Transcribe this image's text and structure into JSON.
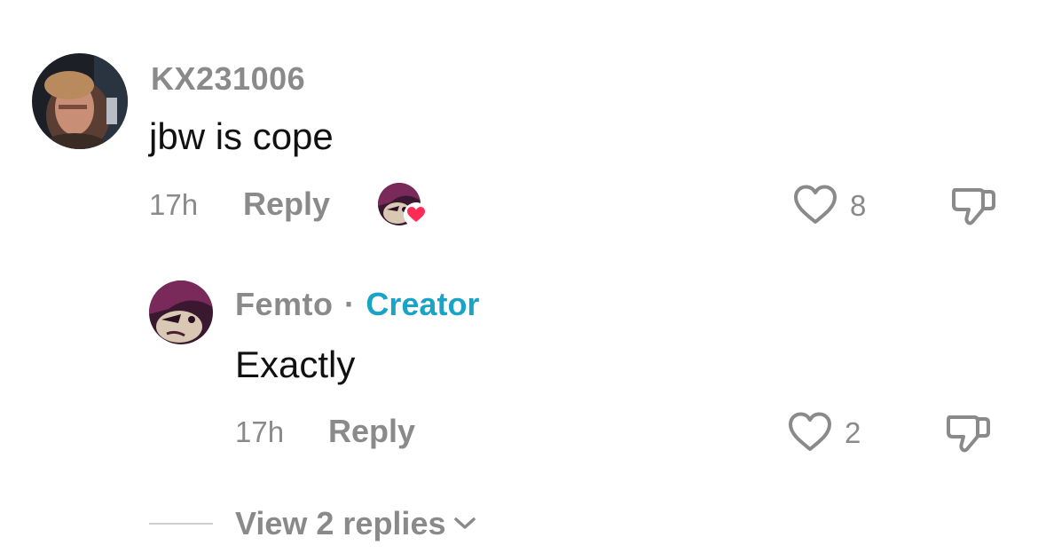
{
  "comment": {
    "username": "KX231006",
    "text": "jbw is cope",
    "time": "17h",
    "reply_label": "Reply",
    "likes": "8",
    "creator_liked": true
  },
  "reply": {
    "username": "Femto",
    "separator": "·",
    "badge": "Creator",
    "text": "Exactly",
    "time": "17h",
    "reply_label": "Reply",
    "likes": "2"
  },
  "view_replies": {
    "label": "View 2 replies"
  },
  "colors": {
    "accent_creator": "#1aa3c6",
    "heart_badge": "#fe2c55",
    "muted_text": "#8a8a8a"
  },
  "icons": [
    "heart-outline-icon",
    "thumbs-down-icon",
    "chevron-down-icon",
    "heart-filled-icon"
  ]
}
